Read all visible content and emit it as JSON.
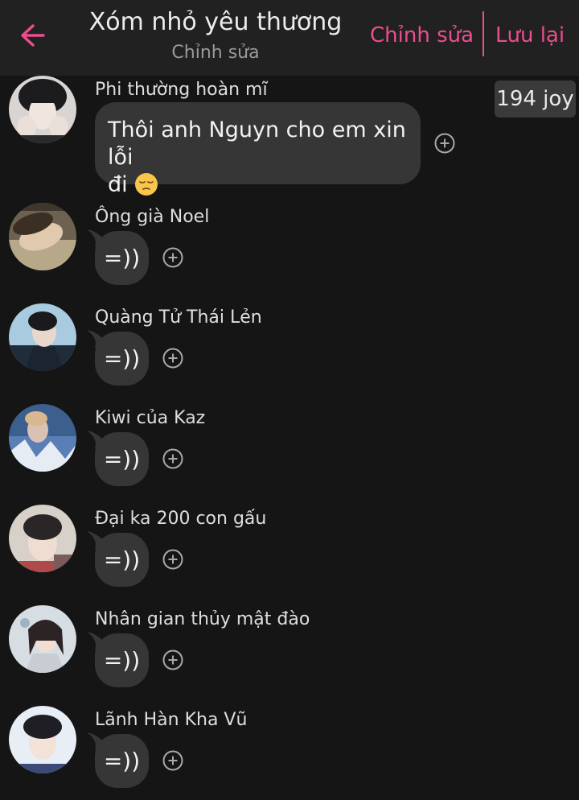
{
  "header": {
    "title": "Xóm nhỏ yêu thương",
    "subtitle": "Chỉnh sửa",
    "edit_label": "Chỉnh sửa",
    "save_label": "Lưu lại",
    "back_icon": "arrow-left-icon",
    "accent_color": "#ea4e90"
  },
  "joy_badge": "194 joy",
  "messages": [
    {
      "sender": "Phi thường hoàn mĩ",
      "text": "Thôi anh Nguyn cho em xin lỗi",
      "text_line2": "đi",
      "emoji": "pensive-face-emoji"
    },
    {
      "sender": "Ông già Noel",
      "text": "=))"
    },
    {
      "sender": "Quàng Tử Thái Lẻn",
      "text": "=))"
    },
    {
      "sender": "Kiwi của Kaz",
      "text": "=))"
    },
    {
      "sender": "Đại ka 200 con gấu",
      "text": "=))"
    },
    {
      "sender": "Nhân gian thủy mật đào",
      "text": "=))"
    },
    {
      "sender": "Lãnh Hàn Kha Vũ",
      "text": "=))"
    }
  ],
  "colors": {
    "background": "#151515",
    "header": "#212121",
    "bubble": "#363636"
  }
}
